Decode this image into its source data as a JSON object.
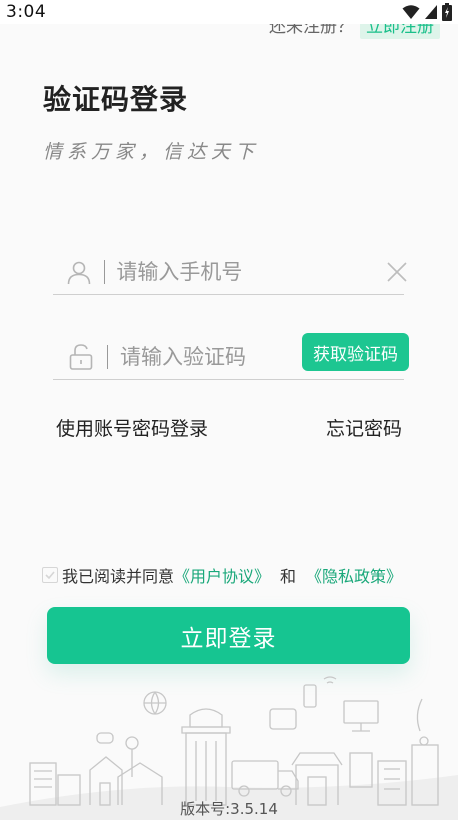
{
  "status_bar": {
    "time": "3:04"
  },
  "register": {
    "hint": "还未注册？",
    "link": "立即注册"
  },
  "title": "验证码登录",
  "slogan": "情系万家，信达天下",
  "phone_field": {
    "placeholder": "请输入手机号",
    "value": ""
  },
  "code_field": {
    "placeholder": "请输入验证码",
    "value": "",
    "get_code_label": "获取验证码"
  },
  "links": {
    "account_login": "使用账号密码登录",
    "forgot_password": "忘记密码"
  },
  "agreement": {
    "prefix": "我已阅读并同意",
    "user_agreement": "《用户协议》",
    "and": "和",
    "privacy_policy": "《隐私政策》",
    "checked": false
  },
  "login_button": "立即登录",
  "version": "版本号:3.5.14",
  "colors": {
    "accent": "#16c591",
    "link": "#1aa87a"
  }
}
